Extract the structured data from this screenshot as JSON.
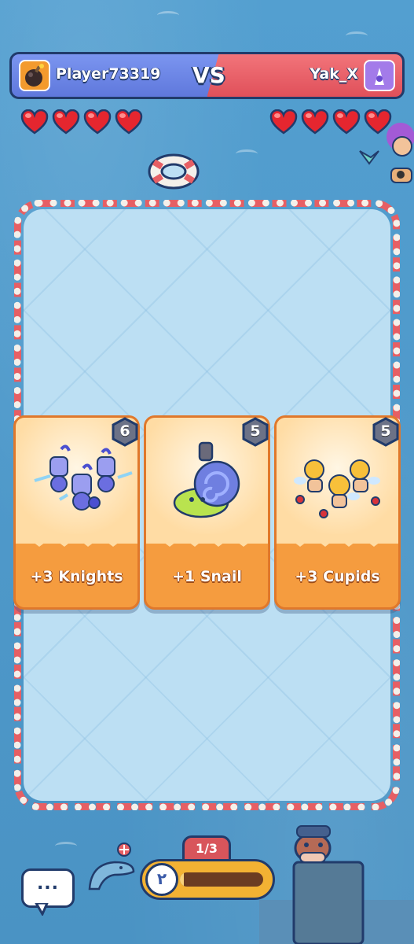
{
  "players": {
    "left": {
      "name": "Player73319",
      "hearts": 4,
      "avatar_icon": "bomb-icon"
    },
    "right": {
      "name": "Yak_X",
      "hearts": 4,
      "avatar_icon": "mage-icon"
    }
  },
  "vs_label": "VS",
  "cards": [
    {
      "label": "+3 Knights",
      "cost": "6",
      "icon": "knights-icon"
    },
    {
      "label": "+1 Snail",
      "cost": "5",
      "icon": "snail-icon"
    },
    {
      "label": "+3 Cupids",
      "cost": "5",
      "icon": "cupids-icon"
    }
  ],
  "wave": {
    "label": "1/3",
    "progress": 0.05,
    "clock_glyph": "٢"
  },
  "chat": {
    "label": "..."
  },
  "colors": {
    "blue_team": "#6a83e6",
    "red_team": "#e85d66",
    "card": "#f59c3f",
    "outline": "#213b6b"
  }
}
